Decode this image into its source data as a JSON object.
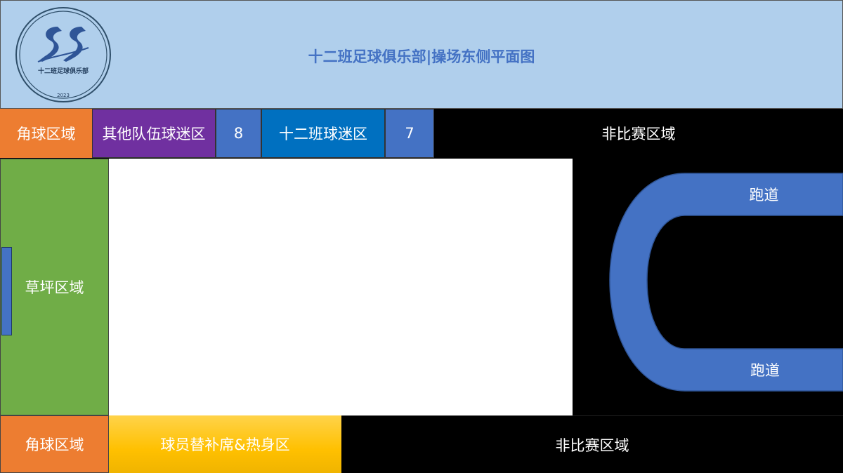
{
  "header": {
    "title": "十二班足球俱乐部|操场东侧平面图",
    "logo": {
      "text": "十二班足球俱乐部",
      "year": "2023",
      "icon": "club-ss-logo",
      "colors": {
        "ring": "#2f4f6a",
        "mark": "#2f5597"
      }
    },
    "background": "#b0cfec"
  },
  "zones": {
    "corner_top": "角球区域",
    "fan_other": "其他队伍球迷区",
    "badge_8": "8",
    "fan_class": "十二班球迷区",
    "badge_7": "7",
    "nonplay_top": "非比赛区域",
    "grass": "草坪区域",
    "track_top": "跑道",
    "track_bottom": "跑道",
    "corner_bottom": "角球区域",
    "bench": "球员替补席&热身区",
    "nonplay_bottom": "非比赛区域"
  },
  "colors": {
    "corner": "#ed7d31",
    "fan_other": "#7030a0",
    "fan_class": "#0070c0",
    "badge": "#4472c4",
    "grass": "#70ad47",
    "track": "#4472c4",
    "bench": "#ffc000",
    "nonplay": "#000000",
    "pitch": "#ffffff"
  }
}
